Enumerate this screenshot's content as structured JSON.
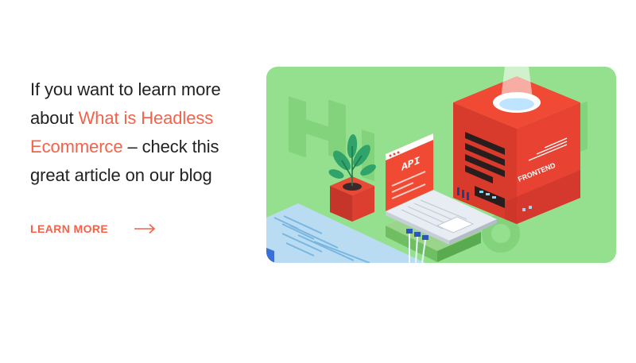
{
  "promo": {
    "text_before": "If you want to learn more about ",
    "link_text": "What is Headless Ecommerce",
    "text_after": " – check this great article on our blog"
  },
  "cta": {
    "label": "LEARN MORE",
    "arrow_icon": "arrow-right-icon"
  },
  "illustration": {
    "api_label": "API",
    "frontend_label": "FRONTEND"
  },
  "colors": {
    "accent": "#f4624a",
    "hero_background": "#95e08f",
    "text": "#222222"
  }
}
